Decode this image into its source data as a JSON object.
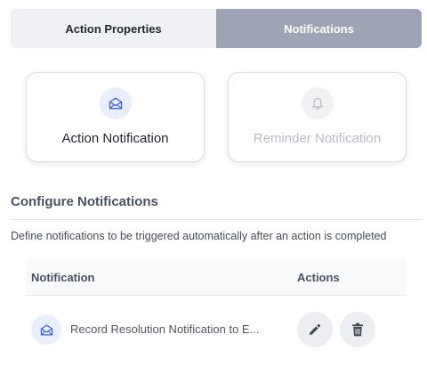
{
  "tabs": [
    {
      "label": "Action Properties",
      "active": false
    },
    {
      "label": "Notifications",
      "active": true
    }
  ],
  "notification_types": [
    {
      "label": "Action Notification",
      "icon": "envelope-icon",
      "enabled": true
    },
    {
      "label": "Reminder Notification",
      "icon": "bell-icon",
      "enabled": false
    }
  ],
  "configure": {
    "title": "Configure Notifications",
    "description": "Define notifications to be triggered automatically after an action is completed"
  },
  "table": {
    "columns": [
      "Notification",
      "Actions"
    ],
    "rows": [
      {
        "text": "Record Resolution Notification to E...",
        "icon": "envelope-icon",
        "actions": [
          "edit-icon",
          "trash-icon"
        ]
      }
    ]
  },
  "colors": {
    "active_tab": "#9ea4b6",
    "inactive_tab": "#eff1f4",
    "accent_blue": "#3d63c7",
    "icon_bg": "#e8eefb"
  }
}
